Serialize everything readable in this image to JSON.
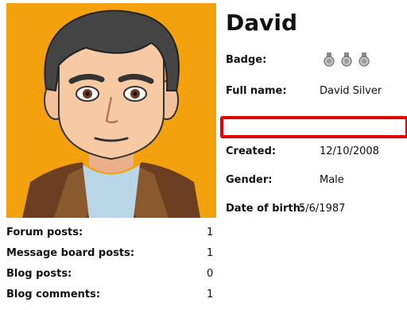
{
  "profile": {
    "name": "David",
    "badge_label": "Badge:",
    "badge_icons": [
      "medal-icon",
      "medal-icon",
      "medal-icon"
    ],
    "fields": [
      {
        "label": "Full name:",
        "value": "David Silver"
      },
      {
        "label": "Created:",
        "value": "12/10/2008"
      },
      {
        "label": "Gender:",
        "value": "Male"
      },
      {
        "label": "Date of birth:",
        "value": "5/6/1987"
      }
    ],
    "avatar_icon": "cartoon-avatar",
    "colors": {
      "avatar_background": "#f3a20d",
      "highlight_border": "#e00000"
    }
  },
  "stats": [
    {
      "label": "Forum posts:",
      "value": "1"
    },
    {
      "label": "Message board posts:",
      "value": "1"
    },
    {
      "label": "Blog posts:",
      "value": "0"
    },
    {
      "label": "Blog comments:",
      "value": "1"
    }
  ]
}
